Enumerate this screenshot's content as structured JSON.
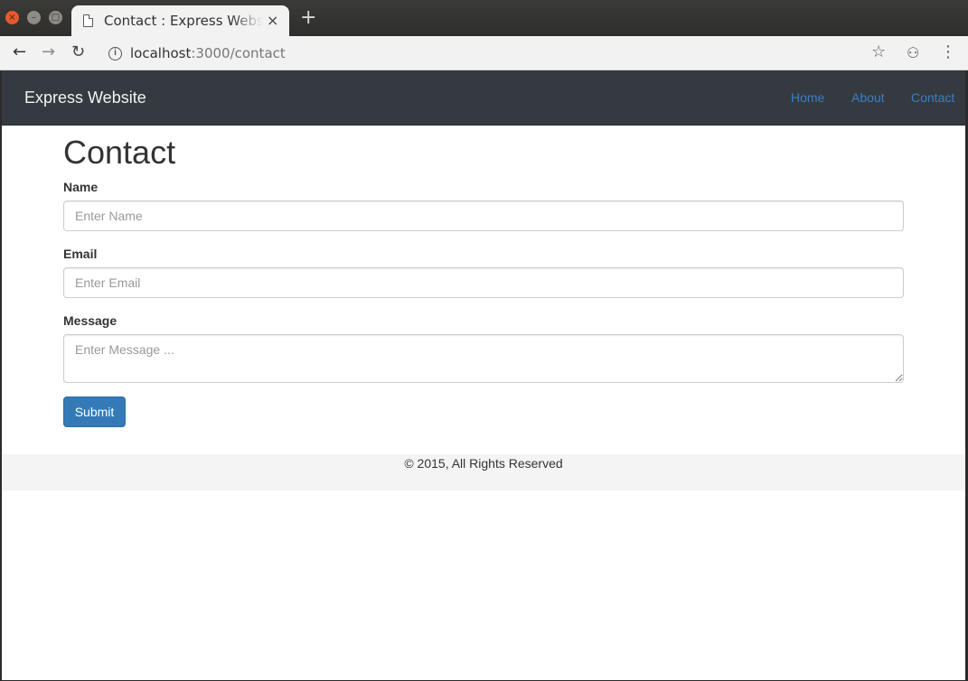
{
  "browser": {
    "window_buttons": {
      "close": "×",
      "minimize": "–",
      "maximize": "□"
    },
    "tab": {
      "title": "Contact : Express Website",
      "close": "×"
    },
    "new_tab": "+",
    "toolbar": {
      "back": "←",
      "forward": "→",
      "reload": "↻",
      "info": "i",
      "url_host": "localhost",
      "url_path": ":3000/contact",
      "bookmark": "☆",
      "incognito": "⚇",
      "menu": "⋮"
    }
  },
  "navbar": {
    "brand": "Express Website",
    "links": [
      "Home",
      "About",
      "Contact"
    ],
    "link_color": "#3d7ec1",
    "background": "#343a40"
  },
  "page": {
    "heading": "Contact",
    "form": {
      "name": {
        "label": "Name",
        "placeholder": "Enter Name",
        "value": ""
      },
      "email": {
        "label": "Email",
        "placeholder": "Enter Email",
        "value": ""
      },
      "message": {
        "label": "Message",
        "placeholder": "Enter Message ...",
        "value": ""
      },
      "submit_label": "Submit",
      "submit_color": "#337ab7"
    }
  },
  "footer": {
    "text": "© 2015, All Rights Reserved"
  }
}
